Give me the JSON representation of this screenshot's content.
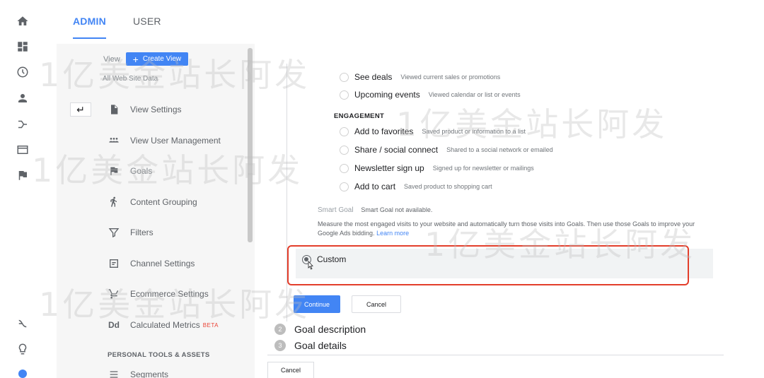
{
  "tabs": [
    {
      "label": "ADMIN",
      "active": true
    },
    {
      "label": "USER",
      "active": false
    }
  ],
  "nav": {
    "view_label": "View",
    "create_view_label": "Create View",
    "view_name": "All Web Site Data",
    "items": [
      {
        "label": "View Settings",
        "icon": "document-icon"
      },
      {
        "label": "View User Management",
        "icon": "people-icon"
      },
      {
        "label": "Goals",
        "icon": "flag-icon",
        "selected": true
      },
      {
        "label": "Content Grouping",
        "icon": "walk-icon"
      },
      {
        "label": "Filters",
        "icon": "filter-icon"
      },
      {
        "label": "Channel Settings",
        "icon": "channel-icon"
      },
      {
        "label": "Ecommerce Settings",
        "icon": "cart-icon"
      },
      {
        "label": "Calculated Metrics",
        "icon": "dd-icon",
        "badge": "BETA"
      }
    ],
    "section_label": "PERSONAL TOOLS & ASSETS",
    "next_item_label": "Segments"
  },
  "goal_setup": {
    "options_top": [
      {
        "label": "See deals",
        "desc": "Viewed current sales or promotions"
      },
      {
        "label": "Upcoming events",
        "desc": "Viewed calendar or list or events"
      }
    ],
    "engagement_header": "ENGAGEMENT",
    "options_engagement": [
      {
        "label": "Add to favorites",
        "desc": "Saved product or information to a list"
      },
      {
        "label": "Share / social connect",
        "desc": "Shared to a social network or emailed"
      },
      {
        "label": "Newsletter sign up",
        "desc": "Signed up for newsletter or mailings"
      },
      {
        "label": "Add to cart",
        "desc": "Saved product to shopping cart"
      }
    ],
    "smart_goal_title": "Smart Goal",
    "smart_goal_status": "Smart Goal not available.",
    "smart_goal_desc": "Measure the most engaged visits to your website and automatically turn those visits into Goals. Then use those Goals to improve your Google Ads bidding.",
    "learn_more": "Learn more",
    "custom_label": "Custom",
    "continue_label": "Continue",
    "cancel_label": "Cancel"
  },
  "steps": [
    {
      "num": "2",
      "label": "Goal description"
    },
    {
      "num": "3",
      "label": "Goal details"
    }
  ],
  "bottom_cancel": "Cancel",
  "watermark": "1亿美金站长阿发"
}
